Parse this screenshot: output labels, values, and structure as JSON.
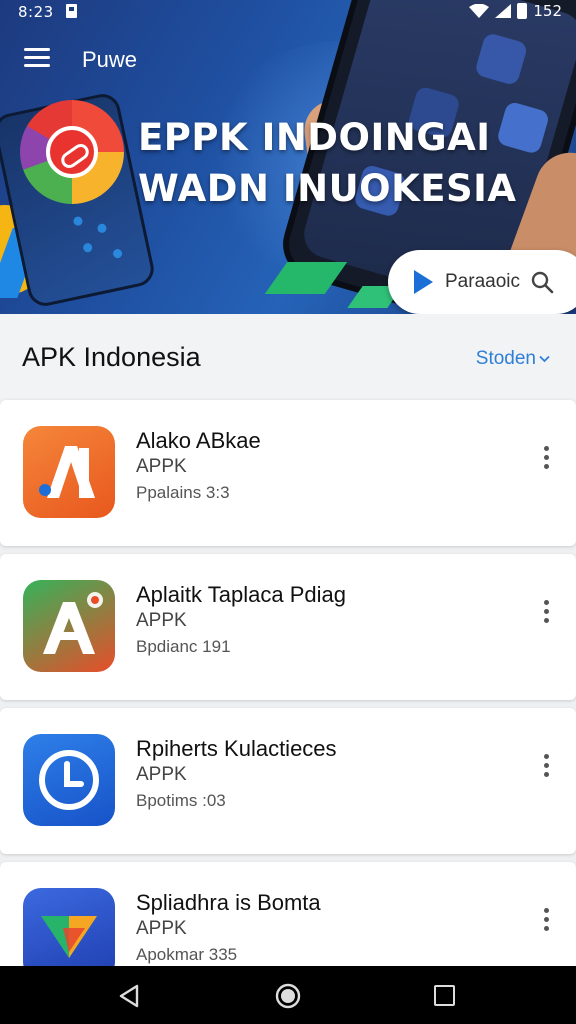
{
  "status_bar": {
    "time": "8:23",
    "battery_text": "152",
    "icons": [
      "notification-icon",
      "wifi-icon",
      "signal-icon",
      "battery-icon"
    ]
  },
  "app_bar": {
    "menu_icon": "menu-icon",
    "title": "Puwe"
  },
  "banner": {
    "headline_line1": "EPPK INDOINGAI",
    "headline_line2": "WADN INUOKESIA",
    "search_pill": {
      "label": "Paraaoic",
      "play_icon": "play-icon",
      "search_icon": "search-icon"
    }
  },
  "section": {
    "title": "APK Indonesia",
    "sort_label": "Stoden",
    "sort_icon": "chevron-down-icon"
  },
  "apps": [
    {
      "name": "Alako ABkae",
      "type": "APPK",
      "meta": "Ppalains 3:3",
      "icon": "orange-a-app-icon"
    },
    {
      "name": "Aplaitk Taplaca Pdiag",
      "type": "APPK",
      "meta": "Bpdianc 191",
      "icon": "green-a-app-icon"
    },
    {
      "name": "Rpiherts Kulactieces",
      "type": "APPK",
      "meta": "Bpotims :03",
      "icon": "clock-app-icon"
    },
    {
      "name": "Spliadhra is Bomta",
      "type": "APPK",
      "meta": "Apokmar 335",
      "icon": "fold-app-icon"
    }
  ],
  "nav_bar": {
    "icons": [
      "back-icon",
      "home-icon",
      "recents-icon"
    ]
  },
  "colors": {
    "banner_blue": "#1f4fa0",
    "accent_link": "#2f7fd6",
    "background": "#eef0f2"
  }
}
